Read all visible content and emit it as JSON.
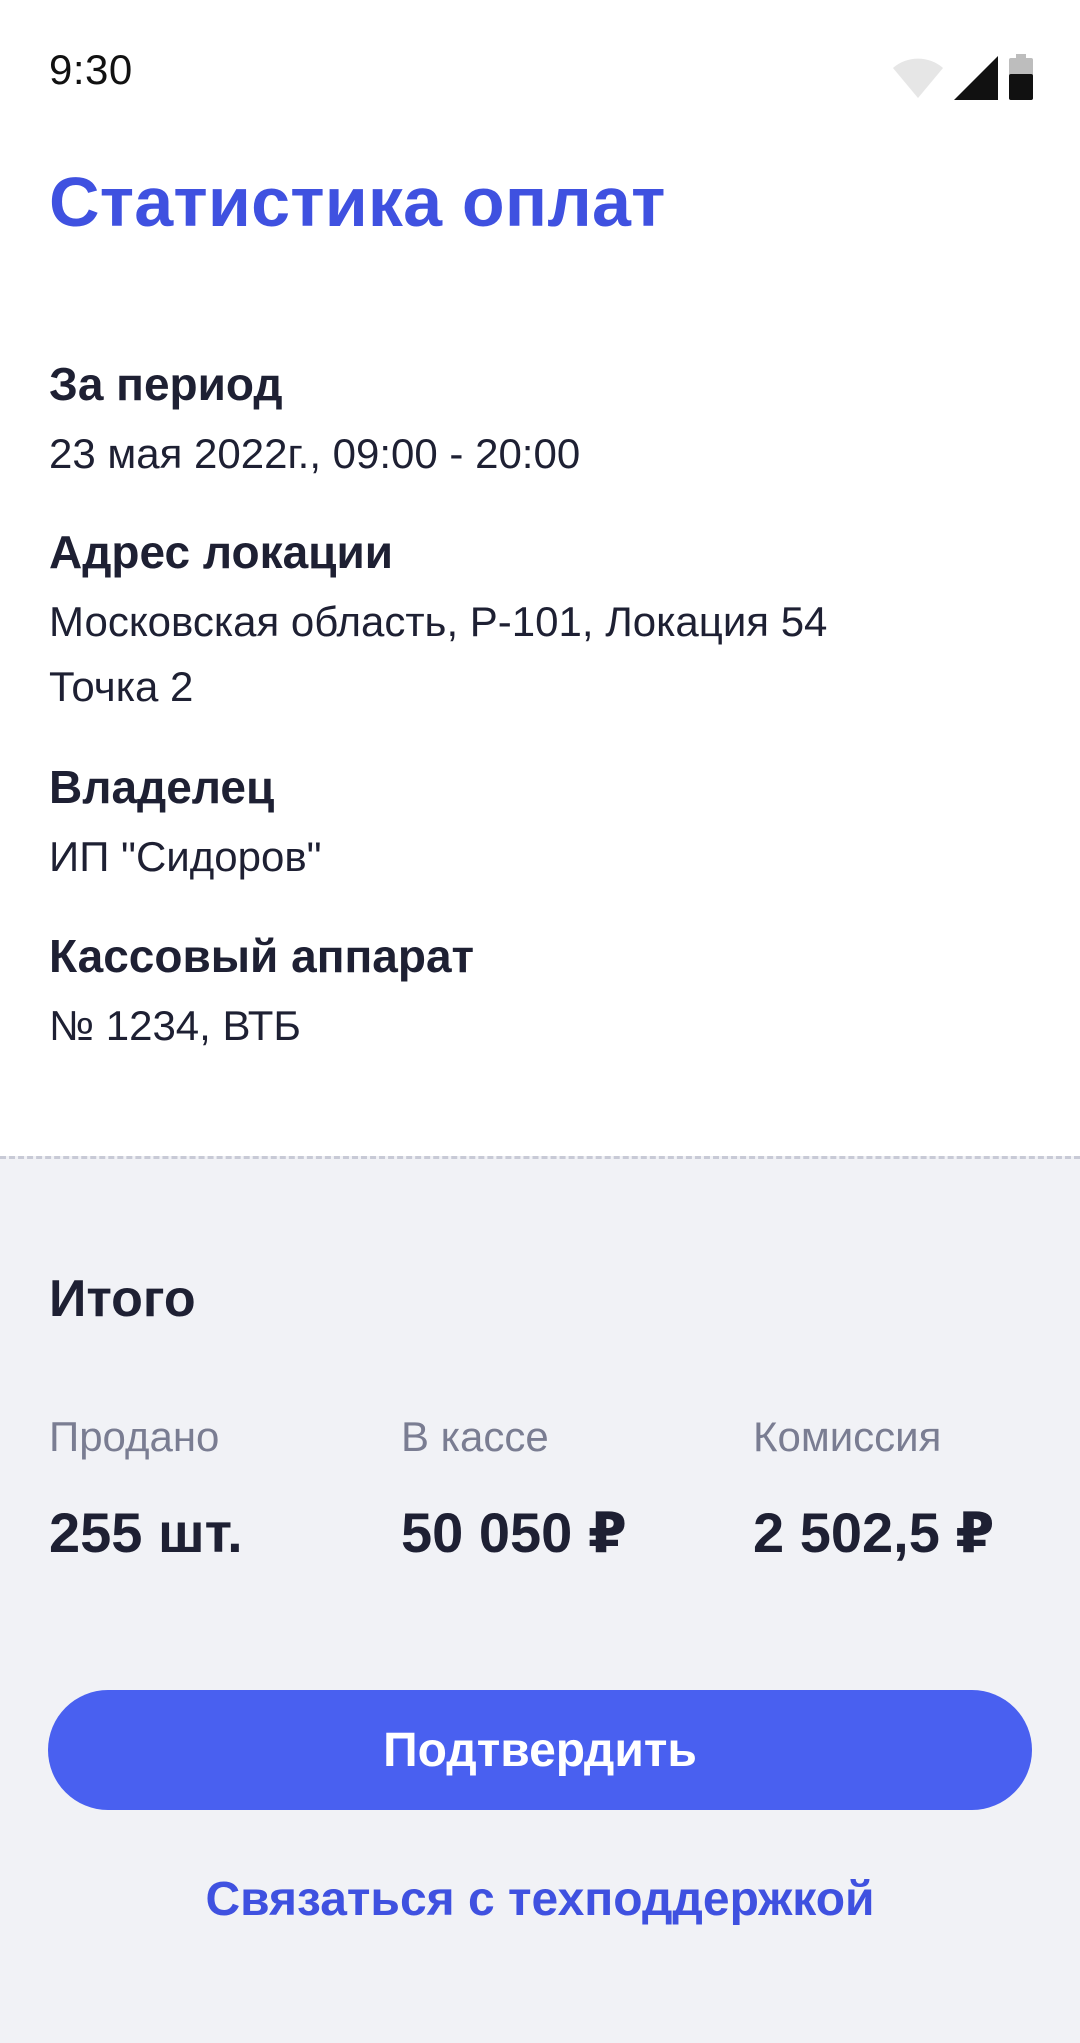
{
  "status_bar": {
    "time": "9:30",
    "icons": [
      "wifi-icon",
      "cellular-signal-icon",
      "battery-icon"
    ]
  },
  "page": {
    "title": "Статистика оплат"
  },
  "info": {
    "period": {
      "label": "За период",
      "value": "23 мая 2022г., 09:00 - 20:00"
    },
    "address": {
      "label": "Адрес локации",
      "value_line1": "Московская область, Р-101, Локация 54",
      "value_line2": "Точка 2"
    },
    "owner": {
      "label": "Владелец",
      "value": "ИП \"Сидоров\""
    },
    "cashbox": {
      "label": "Кассовый аппарат",
      "value": "№ 1234, ВТБ"
    }
  },
  "summary": {
    "title": "Итого",
    "stats": [
      {
        "label": "Продано",
        "value": "255 шт."
      },
      {
        "label": "В кассе",
        "value": "50 050 ₽"
      },
      {
        "label": "Комиссия",
        "value": "2 502,5 ₽"
      }
    ]
  },
  "actions": {
    "confirm_label": "Подтвердить",
    "support_label": "Связаться с техподдержкой"
  },
  "colors": {
    "accent": "#4960f0",
    "title": "#3f51e0",
    "text": "#1e2033",
    "muted": "#7a7d92",
    "summary_bg": "#f1f2f6"
  }
}
